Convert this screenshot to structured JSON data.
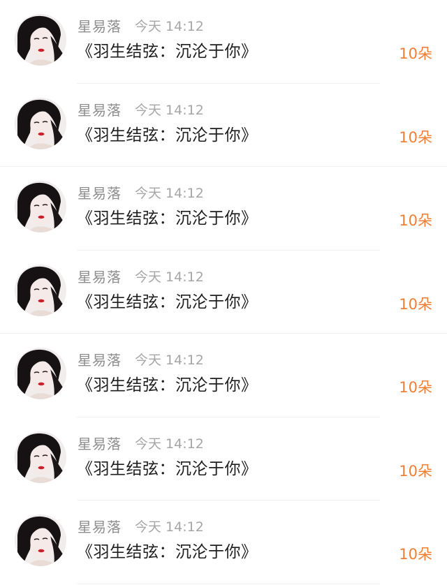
{
  "gift_list": {
    "items": [
      {
        "username": "星易落",
        "time": "今天 14:12",
        "message": "《羽生结弦：沉沦于你》",
        "amount": "10朵"
      },
      {
        "username": "星易落",
        "time": "今天 14:12",
        "message": "《羽生结弦：沉沦于你》",
        "amount": "10朵"
      },
      {
        "username": "星易落",
        "time": "今天 14:12",
        "message": "《羽生结弦：沉沦于你》",
        "amount": "10朵"
      },
      {
        "username": "星易落",
        "time": "今天 14:12",
        "message": "《羽生结弦：沉沦于你》",
        "amount": "10朵"
      },
      {
        "username": "星易落",
        "time": "今天 14:12",
        "message": "《羽生结弦：沉沦于你》",
        "amount": "10朵"
      },
      {
        "username": "星易落",
        "time": "今天 14:12",
        "message": "《羽生结弦：沉沦于你》",
        "amount": "10朵"
      },
      {
        "username": "星易落",
        "time": "今天 14:12",
        "message": "《羽生结弦：沉沦于你》",
        "amount": "10朵"
      }
    ]
  },
  "colors": {
    "amount": "#f07f34",
    "username": "#8e8e8e",
    "time": "#a6a6a6",
    "message": "#1e1e1e"
  },
  "icons": {
    "avatar": "avatar-portrait"
  }
}
